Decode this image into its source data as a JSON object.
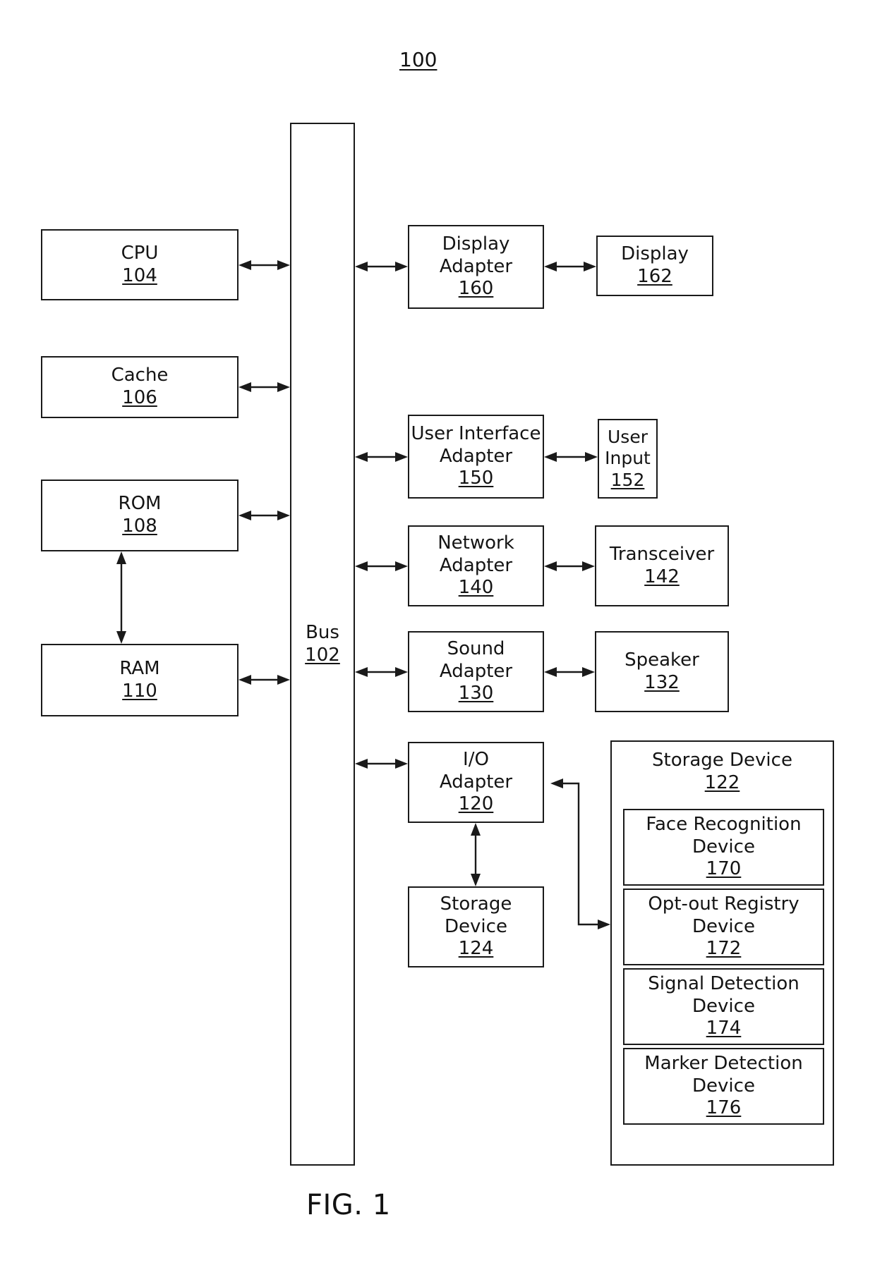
{
  "figure": {
    "system_ref": "100",
    "caption": "FIG. 1"
  },
  "bus": {
    "name": "Bus",
    "ref": "102"
  },
  "left_column": [
    {
      "name": "CPU",
      "ref": "104"
    },
    {
      "name": "Cache",
      "ref": "106"
    },
    {
      "name": "ROM",
      "ref": "108"
    },
    {
      "name": "RAM",
      "ref": "110"
    }
  ],
  "adapters": [
    {
      "name": "Display\nAdapter",
      "ref": "160"
    },
    {
      "name": "User Interface\nAdapter",
      "ref": "150"
    },
    {
      "name": "Network\nAdapter",
      "ref": "140"
    },
    {
      "name": "Sound\nAdapter",
      "ref": "130"
    },
    {
      "name": "I/O\nAdapter",
      "ref": "120"
    }
  ],
  "peripherals": [
    {
      "name": "Display",
      "ref": "162"
    },
    {
      "name": "User\nInput",
      "ref": "152"
    },
    {
      "name": "Transceiver",
      "ref": "142"
    },
    {
      "name": "Speaker",
      "ref": "132"
    }
  ],
  "local_storage": {
    "name": "Storage\nDevice",
    "ref": "124"
  },
  "storage_group": {
    "name": "Storage Device",
    "ref": "122",
    "devices": [
      {
        "name": "Face Recognition\nDevice",
        "ref": "170"
      },
      {
        "name": "Opt-out Registry\nDevice",
        "ref": "172"
      },
      {
        "name": "Signal Detection\nDevice",
        "ref": "174"
      },
      {
        "name": "Marker Detection\nDevice",
        "ref": "176"
      }
    ]
  },
  "colors": {
    "stroke": "#1a1a1a",
    "background": "#ffffff",
    "text": "#141414"
  }
}
